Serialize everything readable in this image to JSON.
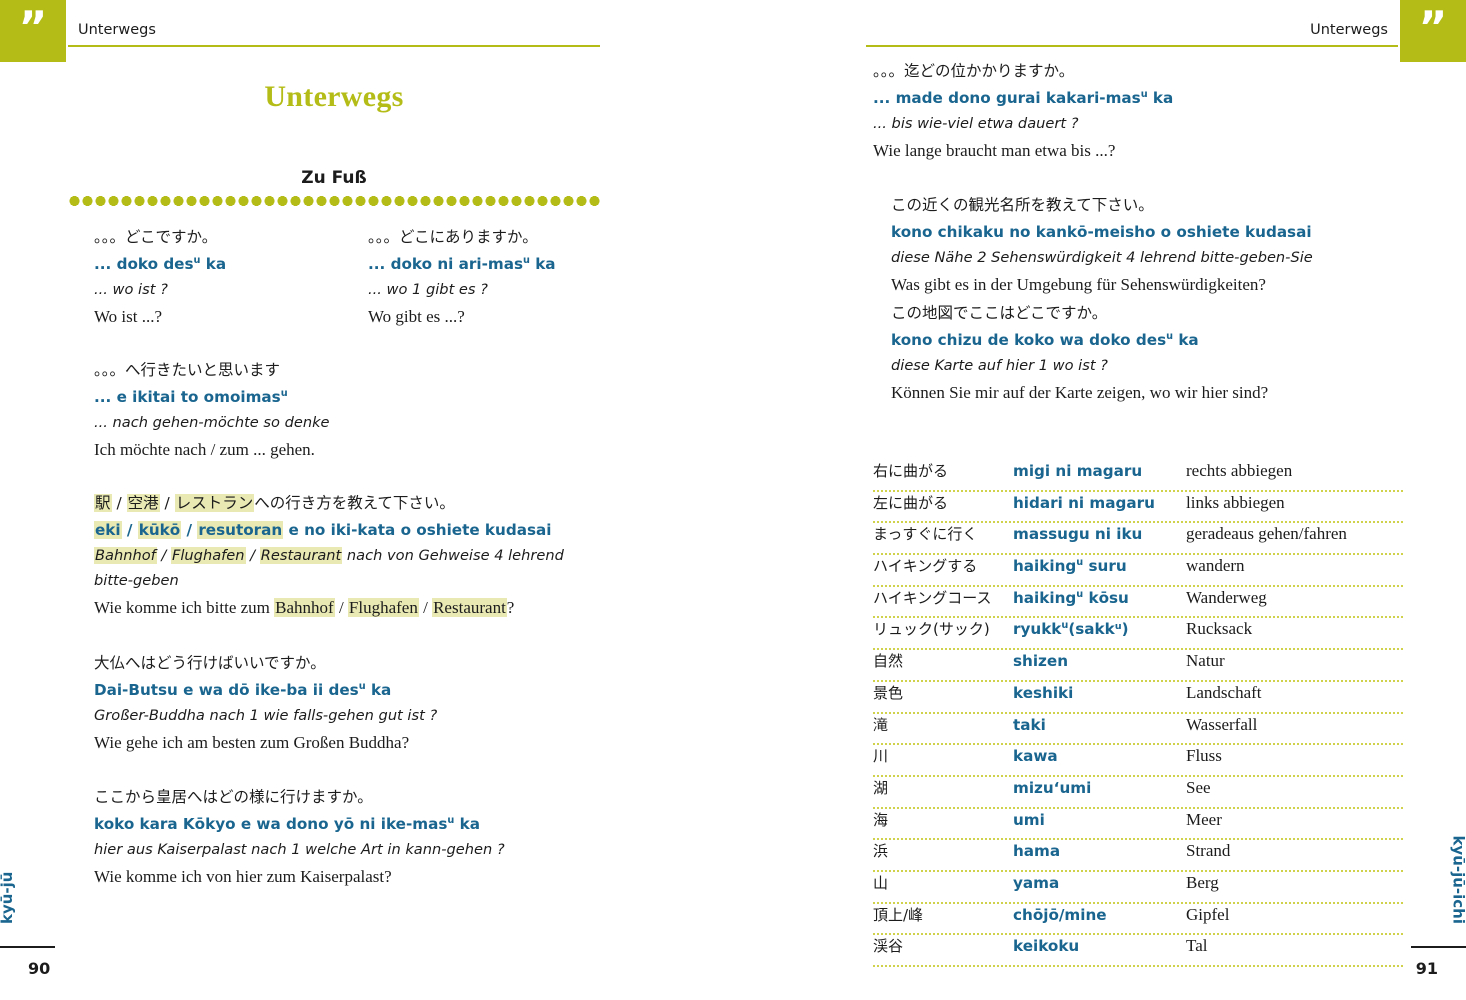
{
  "colors": {
    "accent_green": "#b4bd18",
    "romaji_blue": "#19658f",
    "highlight": "#e9e9b4",
    "dotted_rule": "#cfd24a",
    "text": "#1c1c1c"
  },
  "left_page": {
    "corner_quote_glyph": "”",
    "running_head": "Unterwegs",
    "chapter_title": "Unterwegs",
    "section_title": "Zu Fuß",
    "side_tab": "kyū-jū",
    "folio": "90",
    "blocks": [
      {
        "layout": "two-column",
        "left": {
          "jp": "。。。どこですか。",
          "romaji_pre": "... doko des",
          "romaji_sup": "u",
          "romaji_post": " ka",
          "gloss": "... wo ist ?",
          "de": "Wo ist ...?"
        },
        "right": {
          "jp": "。。。どこにありますか。",
          "romaji_pre": "... doko ni ari-mas",
          "romaji_sup": "u",
          "romaji_post": " ka",
          "gloss": "... wo 1 gibt es ?",
          "de": "Wo gibt es ...?"
        }
      },
      {
        "layout": "single",
        "jp": "。。。へ行きたいと思います",
        "romaji_pre": "... e ikitai to omoimas",
        "romaji_sup": "u",
        "romaji_post": "",
        "gloss": "... nach gehen-möchte so denke",
        "de": "Ich möchte nach / zum ... gehen."
      },
      {
        "layout": "highlight",
        "jp_parts": [
          {
            "t": "駅",
            "hl": true
          },
          {
            "t": " / ",
            "hl": false
          },
          {
            "t": "空港",
            "hl": true
          },
          {
            "t": " / ",
            "hl": false
          },
          {
            "t": "レストラン",
            "hl": true
          },
          {
            "t": "への行き方を教えて下さい。",
            "hl": false
          }
        ],
        "romaji_parts": [
          {
            "t": "eki",
            "hl": true
          },
          {
            "t": " / ",
            "hl": false
          },
          {
            "t": "kūkō",
            "hl": true
          },
          {
            "t": " / ",
            "hl": false
          },
          {
            "t": "resutoran",
            "hl": true
          },
          {
            "t": " e no iki-kata o oshiete kudasai",
            "hl": false
          }
        ],
        "gloss_parts": [
          {
            "t": "Bahnhof",
            "hl": true
          },
          {
            "t": " / ",
            "hl": false
          },
          {
            "t": "Flughafen",
            "hl": true
          },
          {
            "t": " / ",
            "hl": false
          },
          {
            "t": "Restaurant",
            "hl": true
          },
          {
            "t": " nach von Gehweise 4 lehrend bitte-geben",
            "hl": false
          }
        ],
        "de_parts": [
          {
            "t": "Wie komme ich bitte zum ",
            "hl": false
          },
          {
            "t": "Bahnhof",
            "hl": true
          },
          {
            "t": " / ",
            "hl": false
          },
          {
            "t": "Flughafen",
            "hl": true
          },
          {
            "t": " / ",
            "hl": false
          },
          {
            "t": "Restaurant",
            "hl": true
          },
          {
            "t": "?",
            "hl": false
          }
        ]
      },
      {
        "layout": "single",
        "jp": "大仏へはどう行けばいいですか。",
        "romaji_pre": "Dai-Butsu e wa dō ike-ba ii des",
        "romaji_sup": "u",
        "romaji_post": " ka",
        "gloss": "Großer-Buddha nach 1 wie falls-gehen gut ist ?",
        "de": "Wie gehe ich am besten zum Großen Buddha?"
      },
      {
        "layout": "single",
        "jp": "ここから皇居へはどの様に行けますか。",
        "romaji_pre": "koko kara Kōkyo e wa dono yō ni ike-mas",
        "romaji_sup": "u",
        "romaji_post": " ka",
        "gloss": "hier aus Kaiserpalast nach 1 welche Art in kann-gehen ?",
        "de": "Wie komme ich von hier zum Kaiserpalast?"
      }
    ]
  },
  "right_page": {
    "corner_quote_glyph": "”",
    "running_head": "Unterwegs",
    "side_tab": "kyū-jū-ichi",
    "folio": "91",
    "blocks": [
      {
        "jp": "。。。迄どの位かかりますか。",
        "romaji_pre": "... made dono gurai kakari-mas",
        "romaji_sup": "u",
        "romaji_post": " ka",
        "gloss": "... bis wie-viel etwa dauert ?",
        "de": "Wie lange braucht man etwa bis ...?"
      },
      {
        "jp": "この近くの観光名所を教えて下さい。",
        "romaji_pre": "kono chikaku no kankō-meisho o oshiete kudasai",
        "romaji_sup": "",
        "romaji_post": "",
        "gloss": "diese Nähe 2 Sehenswürdigkeit 4 lehrend bitte-geben-Sie",
        "de": "Was gibt es in der Umgebung für Sehenswürdigkeiten?"
      },
      {
        "jp": "この地図でここはどこですか。",
        "romaji_pre": "kono chizu de koko wa doko des",
        "romaji_sup": "u",
        "romaji_post": " ka",
        "gloss": "diese Karte auf hier 1 wo ist ?",
        "de": "Können Sie mir auf der Karte zeigen, wo wir hier sind?"
      }
    ],
    "vocab": [
      {
        "jp": "右に曲がる",
        "romaji": "migi ni magaru",
        "de": "rechts abbiegen"
      },
      {
        "jp": "左に曲がる",
        "romaji": "hidari ni magaru",
        "de": "links abbiegen"
      },
      {
        "jp": "まっすぐに行く",
        "romaji": "massugu ni iku",
        "de": "geradeaus gehen/fahren"
      },
      {
        "jp": "ハイキングする",
        "romaji_pre": "haiking",
        "romaji_sup": "u",
        "romaji_post": " suru",
        "de": "wandern"
      },
      {
        "jp": "ハイキングコース",
        "romaji_pre": "haiking",
        "romaji_sup": "u",
        "romaji_post": " kōsu",
        "de": "Wanderweg"
      },
      {
        "jp": "リュック(サック)",
        "romaji_pre": "ryukk",
        "romaji_sup": "u",
        "romaji_post": "(sakkᵘ)",
        "de": "Rucksack"
      },
      {
        "jp": "自然",
        "romaji": "shizen",
        "de": "Natur"
      },
      {
        "jp": "景色",
        "romaji": "keshiki",
        "de": "Landschaft"
      },
      {
        "jp": "滝",
        "romaji": "taki",
        "de": "Wasserfall"
      },
      {
        "jp": "川",
        "romaji": "kawa",
        "de": "Fluss"
      },
      {
        "jp": "湖",
        "romaji": "mizu‘umi",
        "de": "See"
      },
      {
        "jp": "海",
        "romaji": "umi",
        "de": "Meer"
      },
      {
        "jp": "浜",
        "romaji": "hama",
        "de": "Strand"
      },
      {
        "jp": "山",
        "romaji": "yama",
        "de": "Berg"
      },
      {
        "jp": "頂上/峰",
        "romaji": "chōjō/mine",
        "de": "Gipfel"
      },
      {
        "jp": "渓谷",
        "romaji": "keikoku",
        "de": "Tal"
      }
    ]
  }
}
